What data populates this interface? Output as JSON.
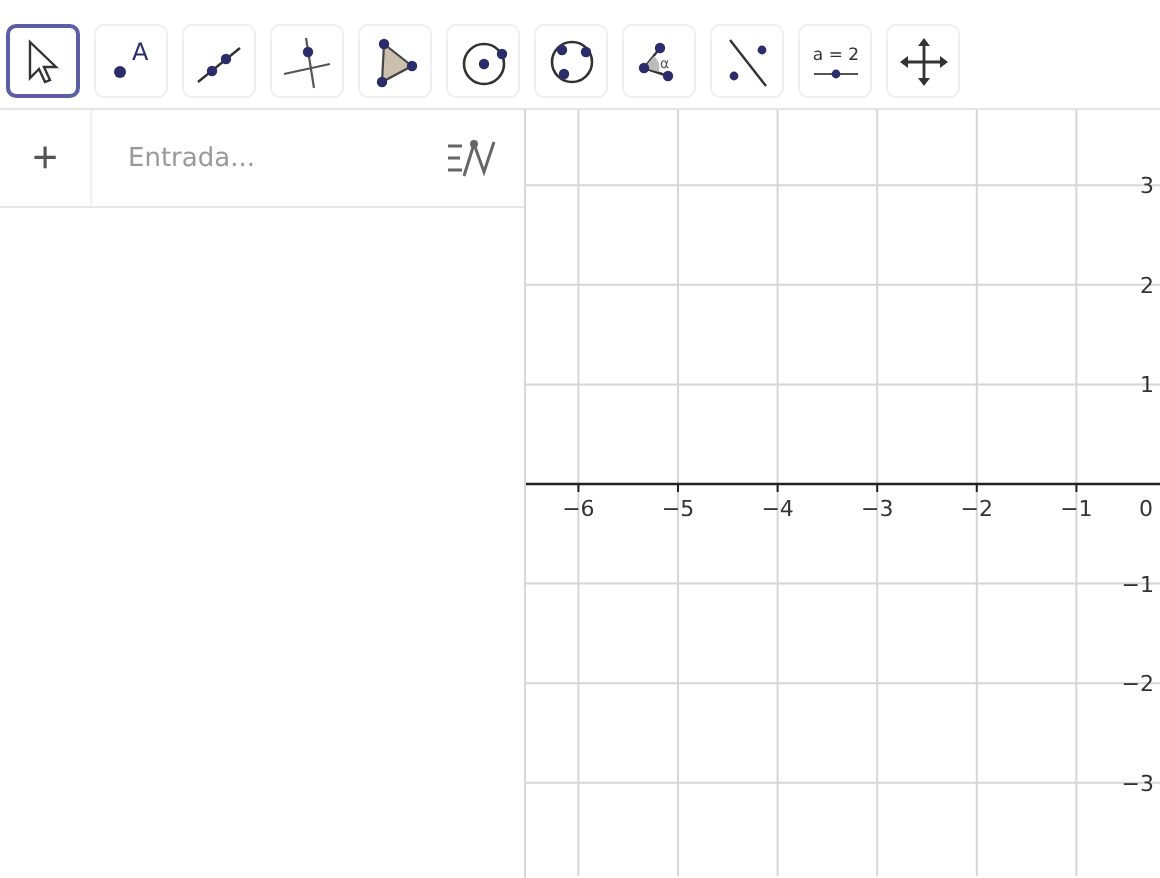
{
  "toolbar": {
    "tools": [
      {
        "kind": "move",
        "selected": true
      },
      {
        "kind": "point",
        "label": "A",
        "selected": false
      },
      {
        "kind": "line",
        "selected": false
      },
      {
        "kind": "perpendicular",
        "selected": false
      },
      {
        "kind": "polygon",
        "selected": false
      },
      {
        "kind": "circle",
        "selected": false
      },
      {
        "kind": "circle3",
        "selected": false
      },
      {
        "kind": "angle",
        "label": "α",
        "selected": false
      },
      {
        "kind": "reflect",
        "selected": false
      },
      {
        "kind": "slider",
        "label": "a = 2",
        "selected": false
      },
      {
        "kind": "pan",
        "selected": false
      }
    ]
  },
  "algebra": {
    "add": "+",
    "input": {
      "placeholder": "Entrada..."
    }
  },
  "graphics": {
    "x_tick_labels": [
      "−6",
      "−5",
      "−4",
      "−3",
      "−2",
      "−1",
      "0"
    ],
    "y_tick_labels": [
      "3",
      "2",
      "1",
      "−1",
      "−2",
      "−3"
    ]
  }
}
